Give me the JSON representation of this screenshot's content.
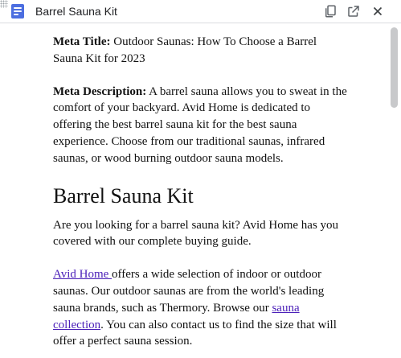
{
  "window": {
    "title": "Barrel Sauna Kit"
  },
  "doc": {
    "meta_title_label": "Meta Title:",
    "meta_title_text": " Outdoor Saunas: How To Choose a Barrel Sauna Kit for 2023",
    "meta_desc_label": "Meta Description:",
    "meta_desc_text": " A barrel sauna allows you to sweat in the comfort of your backyard. Avid Home is dedicated to offering the best barrel sauna kit for the best sauna experience. Choose from our traditional saunas, infrared saunas, or wood burning outdoor sauna models.",
    "heading": "Barrel Sauna Kit",
    "intro": "Are you looking for a barrel sauna kit? Avid Home has you covered with our complete buying guide.",
    "p2_link1": "Avid Home ",
    "p2_text1": "offers a wide selection of indoor or outdoor saunas. Our outdoor saunas are from the world's leading sauna brands, such as Thermory. Browse our ",
    "p2_link2": "sauna collection",
    "p2_text2": ". You can also contact us to find the size that will offer a perfect sauna session."
  },
  "icons": {
    "doc": "document-icon",
    "copy": "copy-icon",
    "open": "open-in-new-icon",
    "close": "close-icon"
  },
  "colors": {
    "doc_icon": "#4c6ee0",
    "link": "#4a1fb8"
  }
}
